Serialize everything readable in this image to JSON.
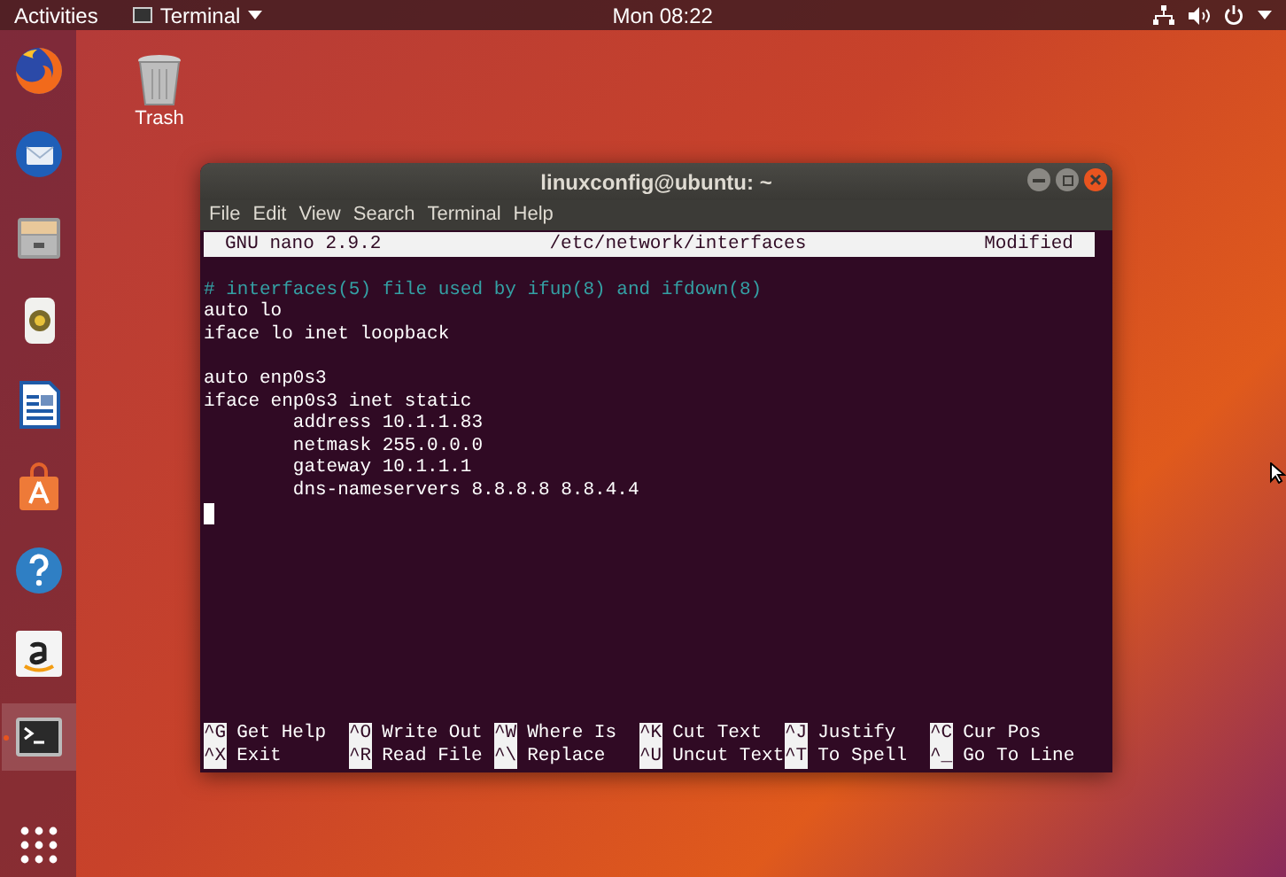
{
  "top_bar": {
    "activities": "Activities",
    "app_menu": "Terminal",
    "clock": "Mon 08:22"
  },
  "dock": {
    "items": [
      {
        "kind": "firefox",
        "selected": false
      },
      {
        "kind": "mail",
        "selected": false
      },
      {
        "kind": "files",
        "selected": false
      },
      {
        "kind": "music",
        "selected": false
      },
      {
        "kind": "writer",
        "selected": false
      },
      {
        "kind": "store",
        "selected": false
      },
      {
        "kind": "help",
        "selected": false
      },
      {
        "kind": "amazon",
        "selected": false
      },
      {
        "kind": "terminal",
        "selected": true
      }
    ]
  },
  "desktop_icons": [
    {
      "label": "Trash"
    }
  ],
  "window": {
    "title": "linuxconfig@ubuntu: ~",
    "menu": [
      "File",
      "Edit",
      "View",
      "Search",
      "Terminal",
      "Help"
    ],
    "nano_header": {
      "version": "GNU nano 2.9.2",
      "file": "/etc/network/interfaces",
      "status": "Modified"
    },
    "lines": [
      {
        "kind": "comment",
        "text": "# interfaces(5) file used by ifup(8) and ifdown(8)"
      },
      {
        "kind": "code",
        "text": "auto lo"
      },
      {
        "kind": "code",
        "text": "iface lo inet loopback"
      },
      {
        "kind": "blank"
      },
      {
        "kind": "code",
        "text": "auto enp0s3"
      },
      {
        "kind": "code",
        "text": "iface enp0s3 inet static"
      },
      {
        "kind": "code",
        "text": "        address 10.1.1.83"
      },
      {
        "kind": "code",
        "text": "        netmask 255.0.0.0"
      },
      {
        "kind": "code",
        "text": "        gateway 10.1.1.1"
      },
      {
        "kind": "code",
        "text": "        dns-nameservers 8.8.8.8 8.8.4.4"
      },
      {
        "kind": "cursor"
      }
    ],
    "shortcuts": [
      {
        "key": "^G",
        "label": "Get Help"
      },
      {
        "key": "^O",
        "label": "Write Out"
      },
      {
        "key": "^W",
        "label": "Where Is"
      },
      {
        "key": "^K",
        "label": "Cut Text"
      },
      {
        "key": "^J",
        "label": "Justify"
      },
      {
        "key": "^C",
        "label": "Cur Pos"
      },
      {
        "key": "^X",
        "label": "Exit"
      },
      {
        "key": "^R",
        "label": "Read File"
      },
      {
        "key": "^\\",
        "label": "Replace"
      },
      {
        "key": "^U",
        "label": "Uncut Text"
      },
      {
        "key": "^T",
        "label": "To Spell"
      },
      {
        "key": "^_",
        "label": "Go To Line"
      }
    ]
  }
}
